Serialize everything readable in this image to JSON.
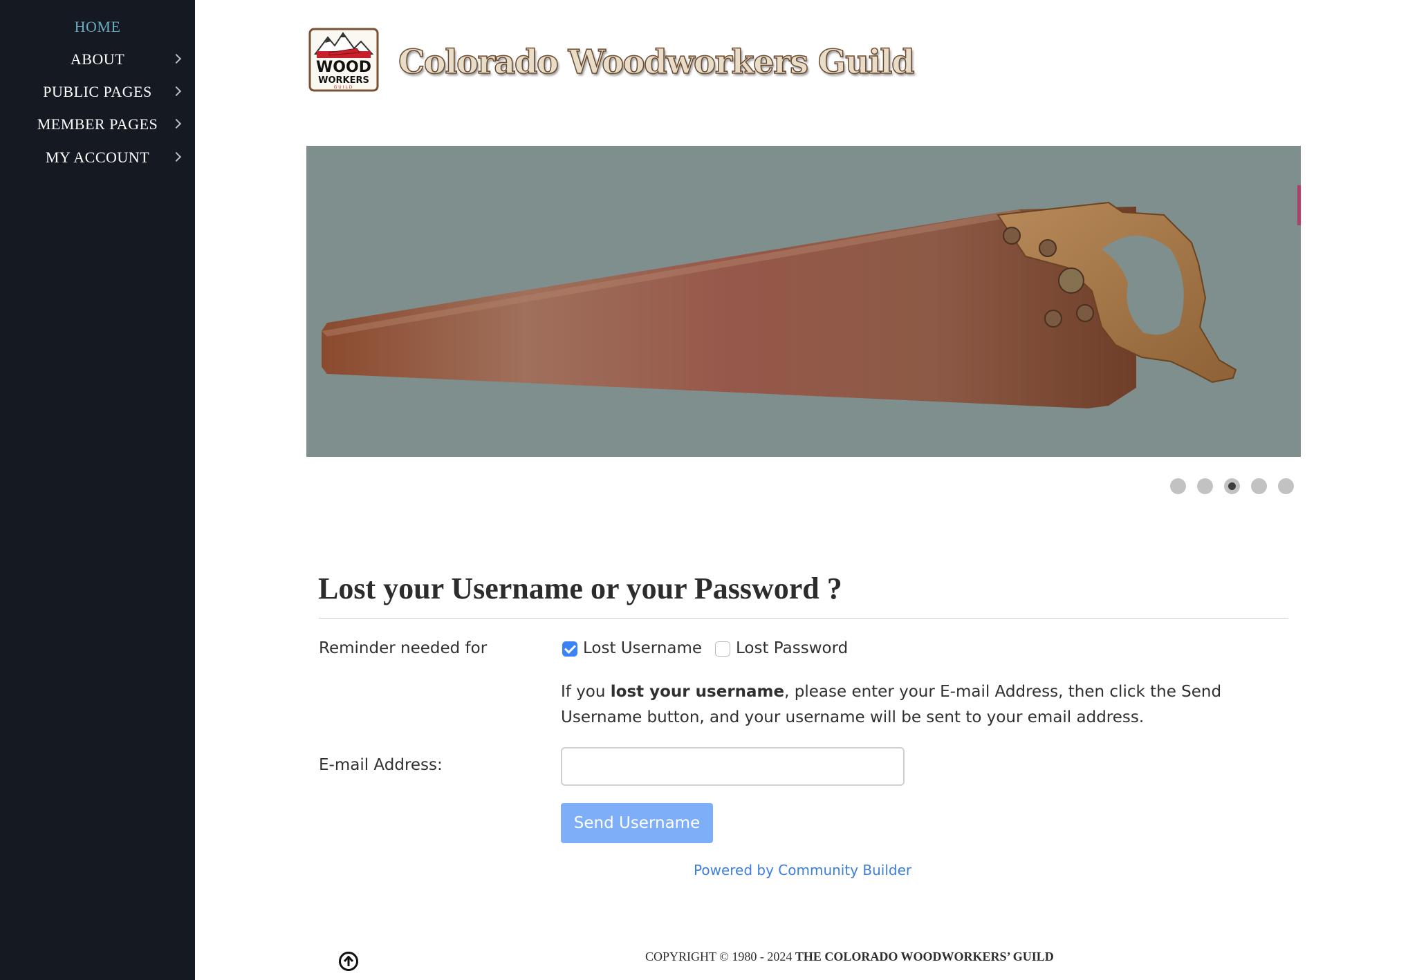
{
  "sidebar": {
    "items": [
      {
        "label": "HOME",
        "active": true,
        "has_submenu": false
      },
      {
        "label": "ABOUT",
        "active": false,
        "has_submenu": true
      },
      {
        "label": "PUBLIC PAGES",
        "active": false,
        "has_submenu": true
      },
      {
        "label": "MEMBER PAGES",
        "active": false,
        "has_submenu": true
      },
      {
        "label": "MY ACCOUNT",
        "active": false,
        "has_submenu": true
      }
    ]
  },
  "header": {
    "logo_badge_text": "COLORADO WOOD WORKERS GUILD",
    "logo_text": "Colorado Woodworkers Guild"
  },
  "slider": {
    "image_alt": "Rusty hand saw",
    "slide_count": 5,
    "active_slide": 3
  },
  "form": {
    "title": "Lost your Username or your Password ?",
    "reminder_label": "Reminder needed for",
    "option_username": "Lost Username",
    "option_password": "Lost Password",
    "username_checked": true,
    "password_checked": false,
    "help_prefix": "If you ",
    "help_bold": "lost your username",
    "help_suffix": ", please enter your E-mail Address, then click the Send Username button, and your username will be sent to your email address.",
    "email_label": "E-mail Address:",
    "email_value": "",
    "submit_label": "Send Username",
    "powered_by": "Powered by Community Builder"
  },
  "footer": {
    "copyright_prefix": "COPYRIGHT © 1980 - 2024 ",
    "copyright_org": "THE COLORADO WOODWORKERS’ GUILD",
    "scroll_top_icon": "arrow-up-circle-icon"
  },
  "colors": {
    "sidebar_bg": "#151a22",
    "nav_active": "#6aa9c2",
    "hero_bg": "#7f8f8d",
    "button_bg": "#7eaef7",
    "checkbox_checked": "#3b82f6",
    "link": "#3c7de0"
  }
}
